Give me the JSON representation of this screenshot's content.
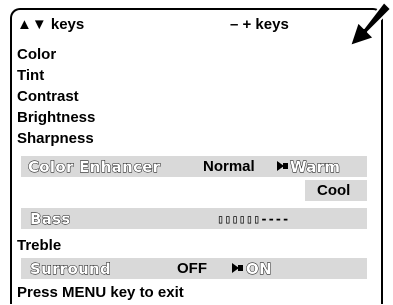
{
  "header": {
    "up_down_keys": "▲▼ keys",
    "minus_plus_keys": "– + keys"
  },
  "menu": {
    "color": "Color",
    "tint": "Tint",
    "contrast": "Contrast",
    "brightness": "Brightness",
    "sharpness": "Sharpness",
    "color_enhancer": {
      "label": "Color Enhancer",
      "options": [
        "Normal",
        "Warm",
        "Cool"
      ],
      "selected": "Warm"
    },
    "bass": {
      "label": "Bass",
      "level_bar": "▯▯▯▯▯▯----"
    },
    "treble": "Treble",
    "surround": {
      "label": "Surround",
      "off": "OFF",
      "on": "ON",
      "selected": "ON"
    }
  },
  "footer": {
    "exit_hint": "Press MENU key to exit"
  },
  "icons": {
    "pointer": "selection-arrow-icon",
    "corner": "pointing-arrow-icon"
  },
  "colors": {
    "band": "#d9d9d9",
    "text": "#000000"
  }
}
